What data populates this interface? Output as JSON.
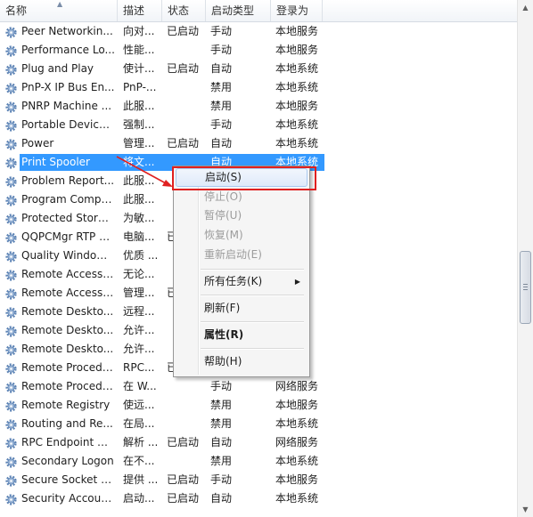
{
  "columns": [
    "名称",
    "描述",
    "状态",
    "启动类型",
    "登录为"
  ],
  "services": [
    {
      "name": "Peer Networkin...",
      "desc": "向对...",
      "status": "已启动",
      "start": "手动",
      "logon": "本地服务"
    },
    {
      "name": "Performance Lo...",
      "desc": "性能...",
      "status": "",
      "start": "手动",
      "logon": "本地服务"
    },
    {
      "name": "Plug and Play",
      "desc": "使计...",
      "status": "已启动",
      "start": "自动",
      "logon": "本地系统"
    },
    {
      "name": "PnP-X IP Bus En...",
      "desc": "PnP-...",
      "status": "",
      "start": "禁用",
      "logon": "本地系统"
    },
    {
      "name": "PNRP Machine ...",
      "desc": "此服...",
      "status": "",
      "start": "禁用",
      "logon": "本地服务"
    },
    {
      "name": "Portable Device ...",
      "desc": "强制...",
      "status": "",
      "start": "手动",
      "logon": "本地系统"
    },
    {
      "name": "Power",
      "desc": "管理...",
      "status": "已启动",
      "start": "自动",
      "logon": "本地系统"
    },
    {
      "name": "Print Spooler",
      "desc": "将文...",
      "status": "",
      "start": "自动",
      "logon": "本地系统"
    },
    {
      "name": "Problem Report...",
      "desc": "此服...",
      "status": "",
      "start": "",
      "logon": "系统"
    },
    {
      "name": "Program Compa...",
      "desc": "此服...",
      "status": "",
      "start": "",
      "logon": "系统"
    },
    {
      "name": "Protected Storage",
      "desc": "为敏...",
      "status": "",
      "start": "",
      "logon": "系统"
    },
    {
      "name": "QQPCMgr RTP S...",
      "desc": "电脑...",
      "status": "已",
      "start": "",
      "logon": "系统"
    },
    {
      "name": "Quality Windows...",
      "desc": "优质 ...",
      "status": "",
      "start": "",
      "logon": "服务"
    },
    {
      "name": "Remote Access ...",
      "desc": "无论...",
      "status": "",
      "start": "",
      "logon": "系统"
    },
    {
      "name": "Remote Access ...",
      "desc": "管理...",
      "status": "已",
      "start": "",
      "logon": "系统"
    },
    {
      "name": "Remote Deskto...",
      "desc": "远程...",
      "status": "",
      "start": "",
      "logon": "系统"
    },
    {
      "name": "Remote Deskto...",
      "desc": "允许...",
      "status": "",
      "start": "",
      "logon": "服务"
    },
    {
      "name": "Remote Deskto...",
      "desc": "允许...",
      "status": "",
      "start": "",
      "logon": "系统"
    },
    {
      "name": "Remote Procedu...",
      "desc": "RPC...",
      "status": "已",
      "start": "",
      "logon": "服务"
    },
    {
      "name": "Remote Procedu...",
      "desc": "在 W...",
      "status": "",
      "start": "手动",
      "logon": "网络服务"
    },
    {
      "name": "Remote Registry",
      "desc": "使远...",
      "status": "",
      "start": "禁用",
      "logon": "本地服务"
    },
    {
      "name": "Routing and Re...",
      "desc": "在局...",
      "status": "",
      "start": "禁用",
      "logon": "本地系统"
    },
    {
      "name": "RPC Endpoint M...",
      "desc": "解析 ...",
      "status": "已启动",
      "start": "自动",
      "logon": "网络服务"
    },
    {
      "name": "Secondary Logon",
      "desc": "在不...",
      "status": "",
      "start": "禁用",
      "logon": "本地系统"
    },
    {
      "name": "Secure Socket T...",
      "desc": "提供 ...",
      "status": "已启动",
      "start": "手动",
      "logon": "本地服务"
    },
    {
      "name": "Security Account...",
      "desc": "启动...",
      "status": "已启动",
      "start": "自动",
      "logon": "本地系统"
    }
  ],
  "selected_index": 7,
  "context_menu": {
    "start": "启动(S)",
    "stop": "停止(O)",
    "pause": "暂停(U)",
    "resume": "恢复(M)",
    "restart": "重新启动(E)",
    "all_tasks": "所有任务(K)",
    "refresh": "刷新(F)",
    "properties": "属性(R)",
    "help": "帮助(H)"
  },
  "colors": {
    "selection": "#3399ff",
    "annotation": "#e02020",
    "gear": "#5b82b4"
  }
}
